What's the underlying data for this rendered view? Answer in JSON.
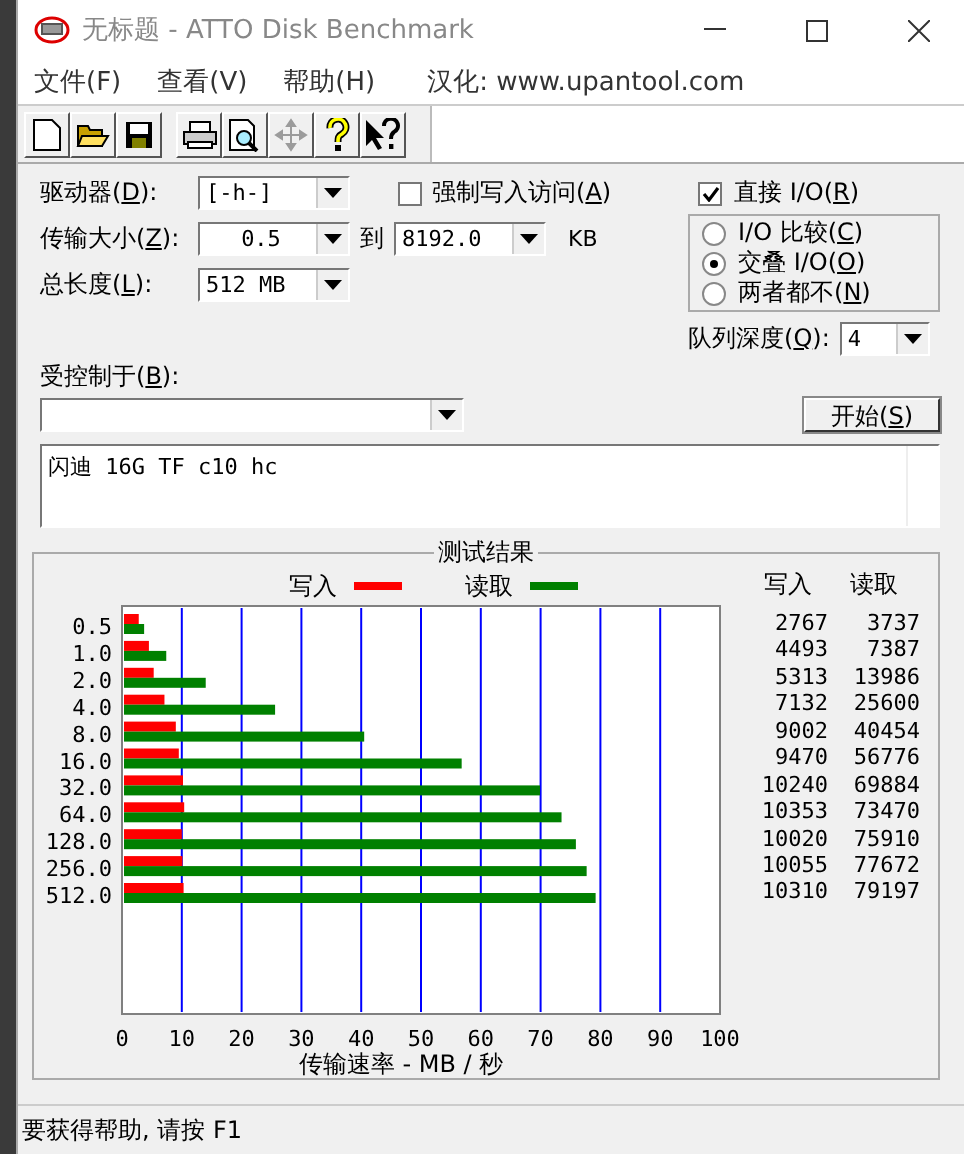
{
  "window": {
    "title": "无标题 - ATTO Disk Benchmark"
  },
  "menu": [
    {
      "label": "文件(F)"
    },
    {
      "label": "查看(V)"
    },
    {
      "label": "帮助(H)"
    }
  ],
  "menu_note": "汉化: www.upantool.com",
  "toolbar": [
    {
      "kind": "new",
      "disabled": false
    },
    {
      "kind": "open",
      "disabled": false
    },
    {
      "kind": "save",
      "disabled": false
    },
    {
      "kind": "print",
      "disabled": false
    },
    {
      "kind": "preview",
      "disabled": false
    },
    {
      "kind": "move",
      "disabled": true
    },
    {
      "kind": "help",
      "disabled": false
    },
    {
      "kind": "context-help",
      "disabled": false
    }
  ],
  "drive": {
    "label": "驱动器(D):",
    "value": "[-h-]"
  },
  "transfer_size": {
    "label": "传输大小(Z):",
    "from": "0.5",
    "to_label": "到",
    "to": "8192.0",
    "unit": "KB"
  },
  "total_length": {
    "label": "总长度(L):",
    "value": "512 MB"
  },
  "force_write": {
    "label": "强制写入访问(A)",
    "checked": false
  },
  "direct_io": {
    "label": "直接 I/O(R)",
    "checked": true
  },
  "io_mode": [
    {
      "label": "I/O 比较(C)",
      "selected": false
    },
    {
      "label": "交叠 I/O(O)",
      "selected": true
    },
    {
      "label": "两者都不(N)",
      "selected": false
    }
  ],
  "queue_depth": {
    "label": "队列深度(Q):",
    "value": "4"
  },
  "controlled_by": {
    "label": "受控制于(B):"
  },
  "start_button": "开始(S)",
  "description": "闪迪 16G TF c10 hc",
  "results": {
    "title": "测试结果",
    "chart_data": {
      "type": "bar",
      "orientation": "horizontal",
      "xlabel": "传输速率 - MB / 秒",
      "categories": [
        "0.5",
        "1.0",
        "2.0",
        "4.0",
        "8.0",
        "16.0",
        "32.0",
        "64.0",
        "128.0",
        "256.0",
        "512.0"
      ],
      "series": [
        {
          "name": "写入",
          "color": "#ff0000",
          "values": [
            2.8,
            4.5,
            5.3,
            7.1,
            9.0,
            9.5,
            10.2,
            10.4,
            10.0,
            10.1,
            10.3
          ]
        },
        {
          "name": "读取",
          "color": "#008000",
          "values": [
            3.7,
            7.4,
            14.0,
            25.6,
            40.5,
            56.8,
            69.9,
            73.5,
            75.9,
            77.7,
            79.2
          ]
        }
      ],
      "grid": true,
      "xlim": [
        0,
        100
      ],
      "xticks": [
        0,
        10,
        20,
        30,
        40,
        50,
        60,
        70,
        80,
        90,
        100
      ]
    },
    "columns": [
      "写入",
      "读取"
    ],
    "rows": [
      [
        "2767",
        "3737"
      ],
      [
        "4493",
        "7387"
      ],
      [
        "5313",
        "13986"
      ],
      [
        "7132",
        "25600"
      ],
      [
        "9002",
        "40454"
      ],
      [
        "9470",
        "56776"
      ],
      [
        "10240",
        "69884"
      ],
      [
        "10353",
        "73470"
      ],
      [
        "10020",
        "75910"
      ],
      [
        "10055",
        "77672"
      ],
      [
        "10310",
        "79197"
      ]
    ]
  },
  "status_bar": "要获得帮助, 请按 F1"
}
